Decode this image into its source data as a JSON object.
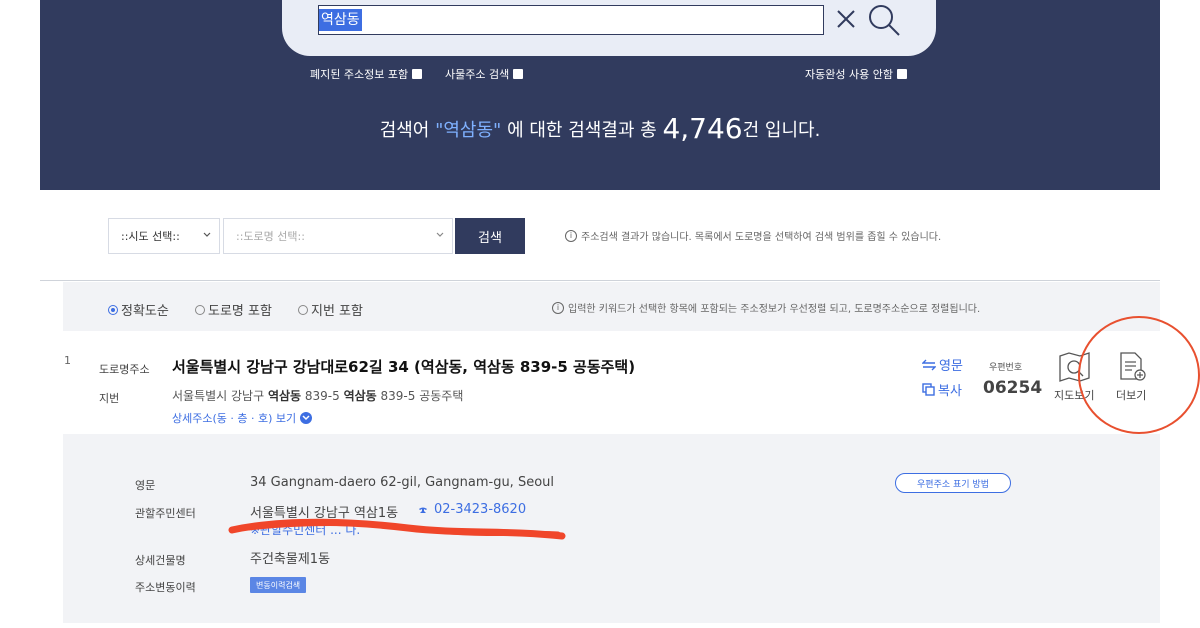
{
  "search": {
    "query": "역삼동"
  },
  "options": {
    "closed_address": "폐지된 주소정보 포함",
    "thing_address": "사물주소 검색",
    "autocomplete_off": "자동완성 사용 안함"
  },
  "summary": {
    "prefix": "검색어 ",
    "keyword": "\"역삼동\"",
    "middle": " 에 대한 검색결과 총 ",
    "count": "4,746",
    "suffix": "건 입니다."
  },
  "filters": {
    "sido_placeholder": "::시도 선택::",
    "road_placeholder": "::도로명 선택::",
    "search_label": "검색",
    "hint": "주소검색 결과가 많습니다. 목록에서 도로명을 선택하여 검색 범위를 좁힐 수 있습니다."
  },
  "sort": {
    "options": [
      "정확도순",
      "도로명 포함",
      "지번 포함"
    ],
    "selected": "정확도순",
    "hint": "입력한 키워드가 선택한 항목에 포함되는 주소정보가 우선정렬 되고, 도로명주소순으로 정렬됩니다."
  },
  "result": {
    "index": "1",
    "road_label": "도로명주소",
    "road_address": "서울특별시 강남구 강남대로62길 34 (역삼동, 역삼동 839-5 공동주택)",
    "jibun_label": "지번",
    "jibun_parts": [
      "서울특별시 강남구 ",
      "역삼동",
      " 839-5 ",
      "역삼동",
      " 839-5 공동주택"
    ],
    "detail_link": "상세주소(동 · 층 · 호) 보기",
    "english_link": "영문",
    "copy_link": "복사",
    "zip_label": "우편번호",
    "zip": "06254",
    "map_label": "지도보기",
    "more_label": "더보기"
  },
  "detail": {
    "english_label": "영문",
    "english_value": "34 Gangnam-daero 62-gil, Gangnam-gu, Seoul",
    "center_label": "관할주민센터",
    "center_value": "서울특별시 강남구 역삼1동",
    "center_phone": "02-3423-8620",
    "note": "※관할주민센터 ... 다.",
    "building_label": "상세건물명",
    "building_value": "주건축물제1동",
    "history_label": "주소변동이력",
    "history_button": "변동이력검색",
    "zip_guide_button": "우편주소 표기 방법"
  },
  "colors": {
    "header_bg": "#313b5e",
    "accent_blue": "#3d6ee2",
    "annotation_red": "#e8502f"
  }
}
